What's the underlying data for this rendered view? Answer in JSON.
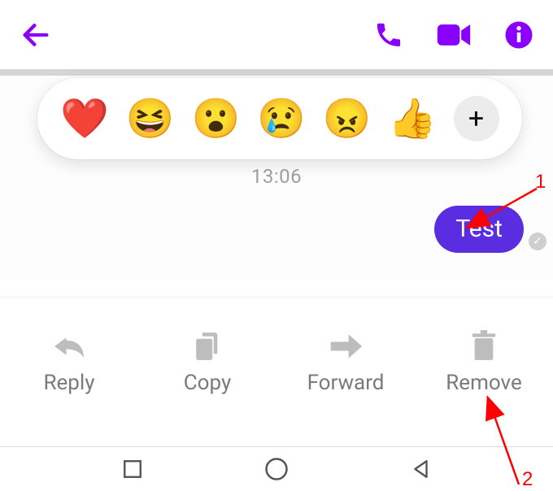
{
  "topbar": {
    "back_icon": "back-arrow",
    "call_icon": "phone",
    "video_icon": "video-camera",
    "info_icon": "info"
  },
  "reactions": {
    "heart": "❤️",
    "laugh": "😆",
    "wow": "😮",
    "sad": "😢",
    "angry": "😠",
    "thumbs": "👍",
    "plus": "+"
  },
  "chat": {
    "timestamp": "13:06",
    "message_text": "Test",
    "status_icon": "✓"
  },
  "actions": {
    "reply": "Reply",
    "copy": "Copy",
    "forward": "Forward",
    "remove": "Remove"
  },
  "annotations": {
    "label1": "1",
    "label2": "2"
  },
  "colors": {
    "accent": "#8a00ff",
    "bubble": "#5a2de0",
    "arrow": "#ff0000"
  }
}
